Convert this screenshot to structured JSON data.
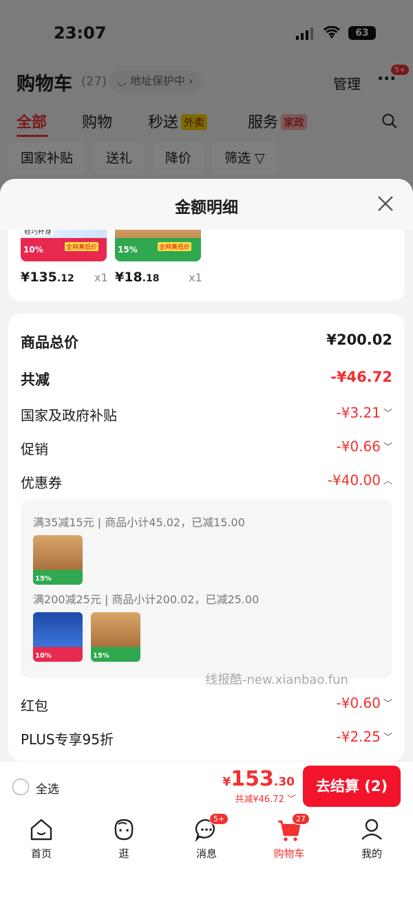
{
  "status_bar": {
    "time": "23:07",
    "battery": "63"
  },
  "header": {
    "title": "购物车",
    "count": "(27)",
    "address": "地址保护中",
    "manage": "管理",
    "more_badge": "5+"
  },
  "tabs": [
    {
      "label": "全部"
    },
    {
      "label": "购物"
    },
    {
      "label": "秒送",
      "tag": "外卖"
    },
    {
      "label": "服务",
      "tag": "家政"
    }
  ],
  "chips": [
    {
      "label": "国家补贴"
    },
    {
      "label": "送礼"
    },
    {
      "label": "降价"
    },
    {
      "label": "筛选"
    }
  ],
  "sheet": {
    "title": "金额明细",
    "products": [
      {
        "price_int": "¥135",
        "price_dec": ".12",
        "qty": "x1",
        "tag_top": "轻巧杯身",
        "tag_pct": "10%",
        "tag_label": "全网真低价"
      },
      {
        "price_int": "¥18",
        "price_dec": ".18",
        "qty": "x1",
        "tag_pct": "15%",
        "tag_label": "全网真低价"
      }
    ],
    "summary": {
      "goods_total_label": "商品总价",
      "goods_total_value": "¥200.02",
      "discount_label": "共减",
      "discount_value": "-¥46.72",
      "subsidy_label": "国家及政府补贴",
      "subsidy_value": "-¥3.21",
      "promo_label": "促销",
      "promo_value": "-¥0.66",
      "coupon_label": "优惠券",
      "coupon_value": "-¥40.00",
      "redpacket_label": "红包",
      "redpacket_value": "-¥0.60",
      "plus_label": "PLUS专享95折",
      "plus_value": "-¥2.25"
    },
    "coupons": [
      {
        "text": "满35减15元 | 商品小计45.02，已减15.00"
      },
      {
        "text": "满200减25元 | 商品小计200.02，已减25.00"
      }
    ],
    "watermark": "线报酷-new.xianbao.fun"
  },
  "checkout": {
    "select_all": "全选",
    "currency": "¥",
    "total_int": "153",
    "total_dec": ".30",
    "saved": "共减¥46.72",
    "button": "去结算 (2)"
  },
  "tabbar": [
    {
      "label": "首页"
    },
    {
      "label": "逛"
    },
    {
      "label": "消息",
      "badge": "5+"
    },
    {
      "label": "购物车",
      "badge": "27"
    },
    {
      "label": "我的"
    }
  ],
  "colors": {
    "accent": "#f23030",
    "button": "#f2142a"
  }
}
